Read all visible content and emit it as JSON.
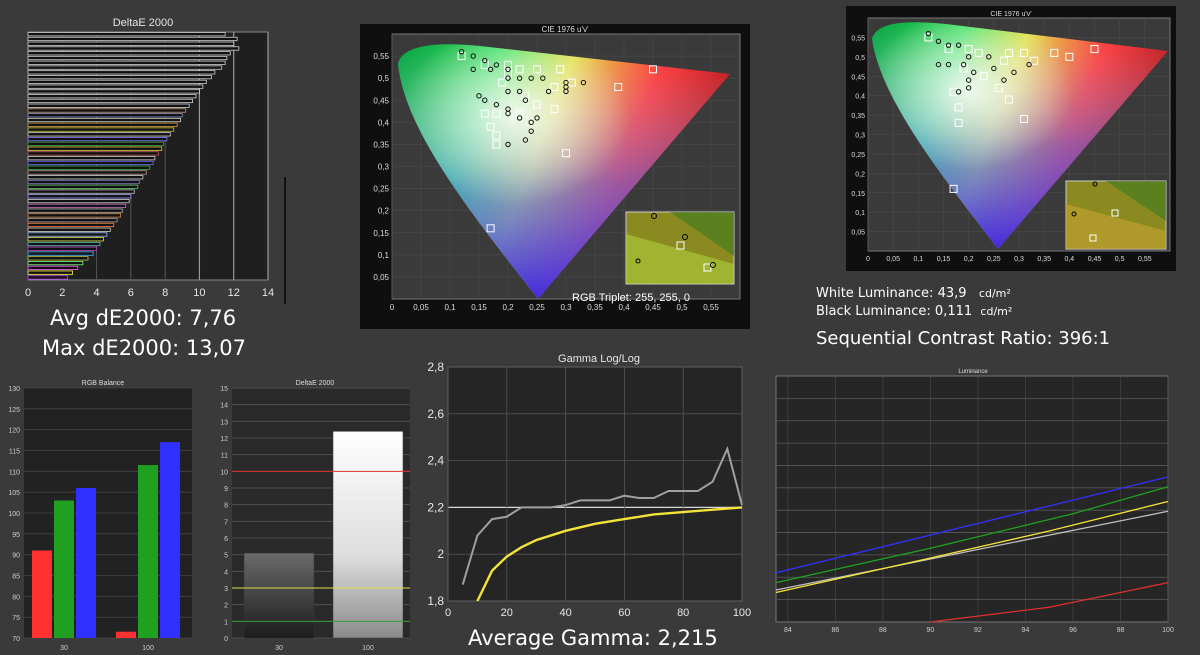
{
  "colors": {
    "background": "#3a3a3a",
    "plot_bg": "#202020",
    "grid": "#5a5a5a",
    "yellow": "#f3e33a",
    "red": "#e23030",
    "green": "#2aa62a",
    "blue": "#3a3ae8"
  },
  "stats": {
    "avg_de": "Avg dE2000: 7,76",
    "max_de": "Max dE2000: 13,07",
    "white_lum_label": "White Luminance: 43,9",
    "white_lum_unit": "cd/m²",
    "black_lum_label": "Black Luminance: 0,111",
    "black_lum_unit": "cd/m²",
    "contrast": "Sequential Contrast Ratio:  396:1",
    "avg_gamma": "Average Gamma: 2,215"
  },
  "chart_data": [
    {
      "id": "deltae_bars",
      "type": "bar",
      "orientation": "horizontal",
      "title": "DeltaE 2000",
      "xticks": [
        "0",
        "2",
        "4",
        "6",
        "8",
        "10",
        "12",
        "14"
      ],
      "xlim": [
        0,
        14
      ],
      "values": [
        11.5,
        12.2,
        12.0,
        12.3,
        11.8,
        11.6,
        11.5,
        11.3,
        10.9,
        10.7,
        10.4,
        10.2,
        10.0,
        9.8,
        9.6,
        9.4,
        9.2,
        9.0,
        8.9,
        8.7,
        8.5,
        8.3,
        8.1,
        7.9,
        7.8,
        7.6,
        7.4,
        7.3,
        7.1,
        6.9,
        6.7,
        6.5,
        6.4,
        6.2,
        6.0,
        5.9,
        5.7,
        5.5,
        5.4,
        5.2,
        5.0,
        4.8,
        4.6,
        4.4,
        4.2,
        4.0,
        3.8,
        3.5,
        3.2,
        2.9,
        2.6,
        2.3
      ],
      "colors": [
        "#d0d0d0",
        "#d0d0d0",
        "#d0d0d0",
        "#d0d0d0",
        "#d0d0d0",
        "#d0d0d0",
        "#d0d0d0",
        "#d0d0d0",
        "#d0d0d0",
        "#d0d0d0",
        "#d0d0d0",
        "#d0d0d0",
        "#d0d0d0",
        "#d0d0d0",
        "#d0d0d0",
        "#d0d0d0",
        "#c8a070",
        "#9090d0",
        "#d0d0d0",
        "#d0a040",
        "#c0c040",
        "#d0d0d0",
        "#8080ff",
        "#40a040",
        "#e0d040",
        "#c06060",
        "#d0d0d0",
        "#7070ff",
        "#40b040",
        "#c0a0a0",
        "#d0d0d0",
        "#8080c0",
        "#60c060",
        "#c0c0c0",
        "#a0a0ff",
        "#d0d0d0",
        "#c070c0",
        "#b0b0b0",
        "#d09050",
        "#a0a0a0",
        "#ff8040",
        "#d0d0d0",
        "#a0c0ff",
        "#e0e040",
        "#60c0c0",
        "#c040c0",
        "#40c0ff",
        "#c0c040",
        "#80ff80",
        "#ff60ff",
        "#ffff40",
        "#c040ff"
      ]
    },
    {
      "id": "cie_main",
      "type": "scatter",
      "title": "CIE 1976 u'v'",
      "xticks": [
        "0",
        "0,05",
        "0,1",
        "0,15",
        "0,2",
        "0,25",
        "0,3",
        "0,35",
        "0,4",
        "0,45",
        "0,5",
        "0,55"
      ],
      "yticks": [
        "0,05",
        "0,1",
        "0,15",
        "0,2",
        "0,25",
        "0,3",
        "0,35",
        "0,4",
        "0,45",
        "0,5",
        "0,55"
      ],
      "xlim": [
        0,
        0.6
      ],
      "ylim": [
        0,
        0.6
      ],
      "targets": [
        [
          0.12,
          0.55
        ],
        [
          0.16,
          0.53
        ],
        [
          0.2,
          0.53
        ],
        [
          0.22,
          0.52
        ],
        [
          0.25,
          0.52
        ],
        [
          0.29,
          0.52
        ],
        [
          0.45,
          0.52
        ],
        [
          0.39,
          0.48
        ],
        [
          0.31,
          0.49
        ],
        [
          0.19,
          0.49
        ],
        [
          0.23,
          0.46
        ],
        [
          0.25,
          0.44
        ],
        [
          0.28,
          0.43
        ],
        [
          0.16,
          0.42
        ],
        [
          0.18,
          0.42
        ],
        [
          0.22,
          0.42
        ],
        [
          0.17,
          0.39
        ],
        [
          0.18,
          0.37
        ],
        [
          0.18,
          0.35
        ],
        [
          0.3,
          0.33
        ],
        [
          0.17,
          0.16
        ],
        [
          0.28,
          0.48
        ],
        [
          0.2,
          0.51
        ]
      ],
      "measured": [
        [
          0.12,
          0.56
        ],
        [
          0.14,
          0.55
        ],
        [
          0.16,
          0.54
        ],
        [
          0.18,
          0.53
        ],
        [
          0.2,
          0.52
        ],
        [
          0.14,
          0.52
        ],
        [
          0.17,
          0.52
        ],
        [
          0.2,
          0.5
        ],
        [
          0.22,
          0.5
        ],
        [
          0.24,
          0.5
        ],
        [
          0.26,
          0.5
        ],
        [
          0.3,
          0.49
        ],
        [
          0.3,
          0.48
        ],
        [
          0.2,
          0.47
        ],
        [
          0.22,
          0.47
        ],
        [
          0.23,
          0.45
        ],
        [
          0.15,
          0.46
        ],
        [
          0.16,
          0.45
        ],
        [
          0.2,
          0.43
        ],
        [
          0.22,
          0.41
        ],
        [
          0.24,
          0.4
        ],
        [
          0.24,
          0.38
        ],
        [
          0.23,
          0.36
        ],
        [
          0.2,
          0.35
        ],
        [
          0.2,
          0.42
        ],
        [
          0.3,
          0.47
        ],
        [
          0.33,
          0.49
        ],
        [
          0.27,
          0.47
        ],
        [
          0.18,
          0.44
        ],
        [
          0.25,
          0.41
        ]
      ],
      "inset_label": "RGB Triplet: 255, 255, 0"
    },
    {
      "id": "cie_right",
      "type": "scatter",
      "title": "CIE 1976 u'v'",
      "xticks": [
        "0",
        "0,05",
        "0,1",
        "0,15",
        "0,2",
        "0,25",
        "0,3",
        "0,35",
        "0,4",
        "0,45",
        "0,5",
        "0,55"
      ],
      "yticks": [
        "0,05",
        "0,1",
        "0,15",
        "0,2",
        "0,25",
        "0,3",
        "0,35",
        "0,4",
        "0,45",
        "0,5",
        "0,55"
      ],
      "xlim": [
        0,
        0.6
      ],
      "ylim": [
        0,
        0.6
      ],
      "targets": [
        [
          0.12,
          0.55
        ],
        [
          0.16,
          0.52
        ],
        [
          0.2,
          0.52
        ],
        [
          0.22,
          0.51
        ],
        [
          0.28,
          0.51
        ],
        [
          0.31,
          0.51
        ],
        [
          0.37,
          0.51
        ],
        [
          0.45,
          0.52
        ],
        [
          0.19,
          0.47
        ],
        [
          0.23,
          0.45
        ],
        [
          0.26,
          0.42
        ],
        [
          0.28,
          0.39
        ],
        [
          0.17,
          0.41
        ],
        [
          0.18,
          0.37
        ],
        [
          0.18,
          0.33
        ],
        [
          0.31,
          0.34
        ],
        [
          0.17,
          0.16
        ],
        [
          0.27,
          0.49
        ],
        [
          0.33,
          0.49
        ],
        [
          0.4,
          0.5
        ]
      ],
      "measured": [
        [
          0.12,
          0.56
        ],
        [
          0.14,
          0.54
        ],
        [
          0.16,
          0.53
        ],
        [
          0.18,
          0.53
        ],
        [
          0.2,
          0.5
        ],
        [
          0.24,
          0.5
        ],
        [
          0.14,
          0.48
        ],
        [
          0.16,
          0.48
        ],
        [
          0.19,
          0.48
        ],
        [
          0.21,
          0.46
        ],
        [
          0.2,
          0.44
        ],
        [
          0.2,
          0.42
        ],
        [
          0.29,
          0.46
        ],
        [
          0.32,
          0.48
        ],
        [
          0.25,
          0.47
        ],
        [
          0.18,
          0.41
        ],
        [
          0.27,
          0.44
        ]
      ]
    },
    {
      "id": "rgb_balance",
      "type": "bar",
      "title": "RGB Balance",
      "categories": [
        "30",
        "100"
      ],
      "yticks": [
        "70",
        "75",
        "80",
        "85",
        "90",
        "95",
        "100",
        "105",
        "110",
        "115",
        "120",
        "125",
        "130"
      ],
      "ylim": [
        70,
        130
      ],
      "series": [
        {
          "color": "#ff3030",
          "values": [
            91,
            71.5
          ]
        },
        {
          "color": "#20a020",
          "values": [
            103,
            111.5
          ]
        },
        {
          "color": "#3030ff",
          "values": [
            106,
            117
          ]
        }
      ]
    },
    {
      "id": "deltae_grey",
      "type": "bar",
      "title": "DeltaE 2000",
      "categories": [
        "30",
        "100"
      ],
      "yticks": [
        "0",
        "1",
        "2",
        "3",
        "4",
        "5",
        "6",
        "7",
        "8",
        "9",
        "10",
        "11",
        "12",
        "13",
        "14",
        "15"
      ],
      "ylim": [
        0,
        15
      ],
      "values": [
        5.1,
        12.4
      ],
      "reference_lines": [
        {
          "value": 10,
          "color": "#e03030"
        },
        {
          "value": 3,
          "color": "#e0e040"
        },
        {
          "value": 1,
          "color": "#30a030"
        }
      ]
    },
    {
      "id": "gamma",
      "type": "line",
      "title": "Gamma Log/Log",
      "xticks": [
        "0",
        "20",
        "40",
        "60",
        "80",
        "100"
      ],
      "yticks": [
        "1,8",
        "2",
        "2,2",
        "2,4",
        "2,6",
        "2,8"
      ],
      "xlim": [
        0,
        100
      ],
      "ylim": [
        1.8,
        2.8
      ],
      "series": [
        {
          "color": "#a0a0a0",
          "x": [
            5,
            10,
            15,
            20,
            25,
            30,
            35,
            40,
            45,
            50,
            55,
            60,
            65,
            70,
            75,
            80,
            85,
            90,
            95,
            100
          ],
          "y": [
            1.87,
            2.08,
            2.15,
            2.16,
            2.2,
            2.2,
            2.2,
            2.21,
            2.23,
            2.23,
            2.23,
            2.25,
            2.24,
            2.24,
            2.27,
            2.27,
            2.27,
            2.31,
            2.45,
            2.21
          ]
        },
        {
          "color": "#f3e33a",
          "x": [
            10,
            15,
            20,
            25,
            30,
            40,
            50,
            60,
            70,
            80,
            90,
            100
          ],
          "y": [
            1.8,
            1.93,
            1.99,
            2.03,
            2.06,
            2.1,
            2.13,
            2.15,
            2.17,
            2.18,
            2.19,
            2.2
          ]
        }
      ]
    },
    {
      "id": "luminance",
      "type": "line",
      "title": "Luminance",
      "xticks": [
        "84",
        "86",
        "88",
        "90",
        "92",
        "94",
        "96",
        "98",
        "100"
      ],
      "xlim": [
        83.5,
        100
      ],
      "series": [
        {
          "color": "#3030ff",
          "x": [
            83.5,
            100
          ],
          "y": [
            0.2,
            0.59
          ]
        },
        {
          "color": "#20a020",
          "x": [
            83.5,
            90,
            96,
            100
          ],
          "y": [
            0.16,
            0.3,
            0.44,
            0.55
          ]
        },
        {
          "color": "#c0c0c0",
          "x": [
            83.5,
            100
          ],
          "y": [
            0.13,
            0.45
          ]
        },
        {
          "color": "#f3e33a",
          "x": [
            83.5,
            90,
            95,
            100
          ],
          "y": [
            0.12,
            0.26,
            0.37,
            0.49
          ]
        },
        {
          "color": "#e03030",
          "x": [
            90,
            95,
            100
          ],
          "y": [
            0.0,
            0.06,
            0.16
          ]
        }
      ]
    }
  ]
}
